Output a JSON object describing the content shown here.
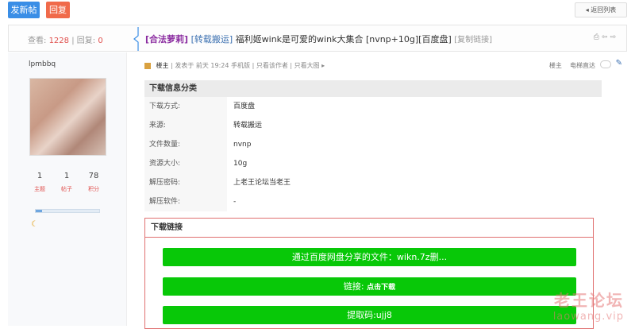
{
  "toolbar": {
    "new_post": "发新帖",
    "reply": "回复",
    "back_to_list": "返回列表"
  },
  "thread": {
    "views_label": "查看:",
    "views": "1228",
    "replies_label": "回复:",
    "replies": "0",
    "category": "[合法萝莉]",
    "prefix": "[转载搬运]",
    "title": "福利姬wink是可爱的wink大集合 [nvnp+10g][百度盘]",
    "copy_link": "[复制链接]"
  },
  "user": {
    "name": "lpmbbq",
    "stats": [
      {
        "value": "1",
        "label": "主题"
      },
      {
        "value": "1",
        "label": "帖子"
      },
      {
        "value": "78",
        "label": "积分"
      }
    ],
    "level_progress": 0.1
  },
  "post": {
    "author_badge": "楼主",
    "posted": "发表于 前天 19:24 手机版",
    "only_author": "只看该作者",
    "only_image": "只看大图",
    "floor": "楼主",
    "elevator": "电梯直达"
  },
  "info": {
    "heading": "下载信息分类",
    "rows": [
      {
        "key": "下载方式:",
        "value": "百度盘"
      },
      {
        "key": "来源:",
        "value": "转载搬运"
      },
      {
        "key": "文件数量:",
        "value": "nvnp"
      },
      {
        "key": "资源大小:",
        "value": "10g"
      },
      {
        "key": "解压密码:",
        "value": "上老王论坛当老王"
      },
      {
        "key": "解压软件:",
        "value": "-"
      }
    ]
  },
  "download": {
    "heading": "下载链接",
    "share_text": "通过百度网盘分享的文件：wikn.7z删...",
    "link_label": "链接:",
    "link_action": "点击下载",
    "code": "提取码:ujj8"
  },
  "watermark": {
    "zh": "老王论坛",
    "en": "laowang.vip"
  },
  "colors": {
    "primary": "#3a8ee6",
    "reply": "#f06a4a",
    "download_green": "#08c808",
    "border_red": "#e07070"
  }
}
